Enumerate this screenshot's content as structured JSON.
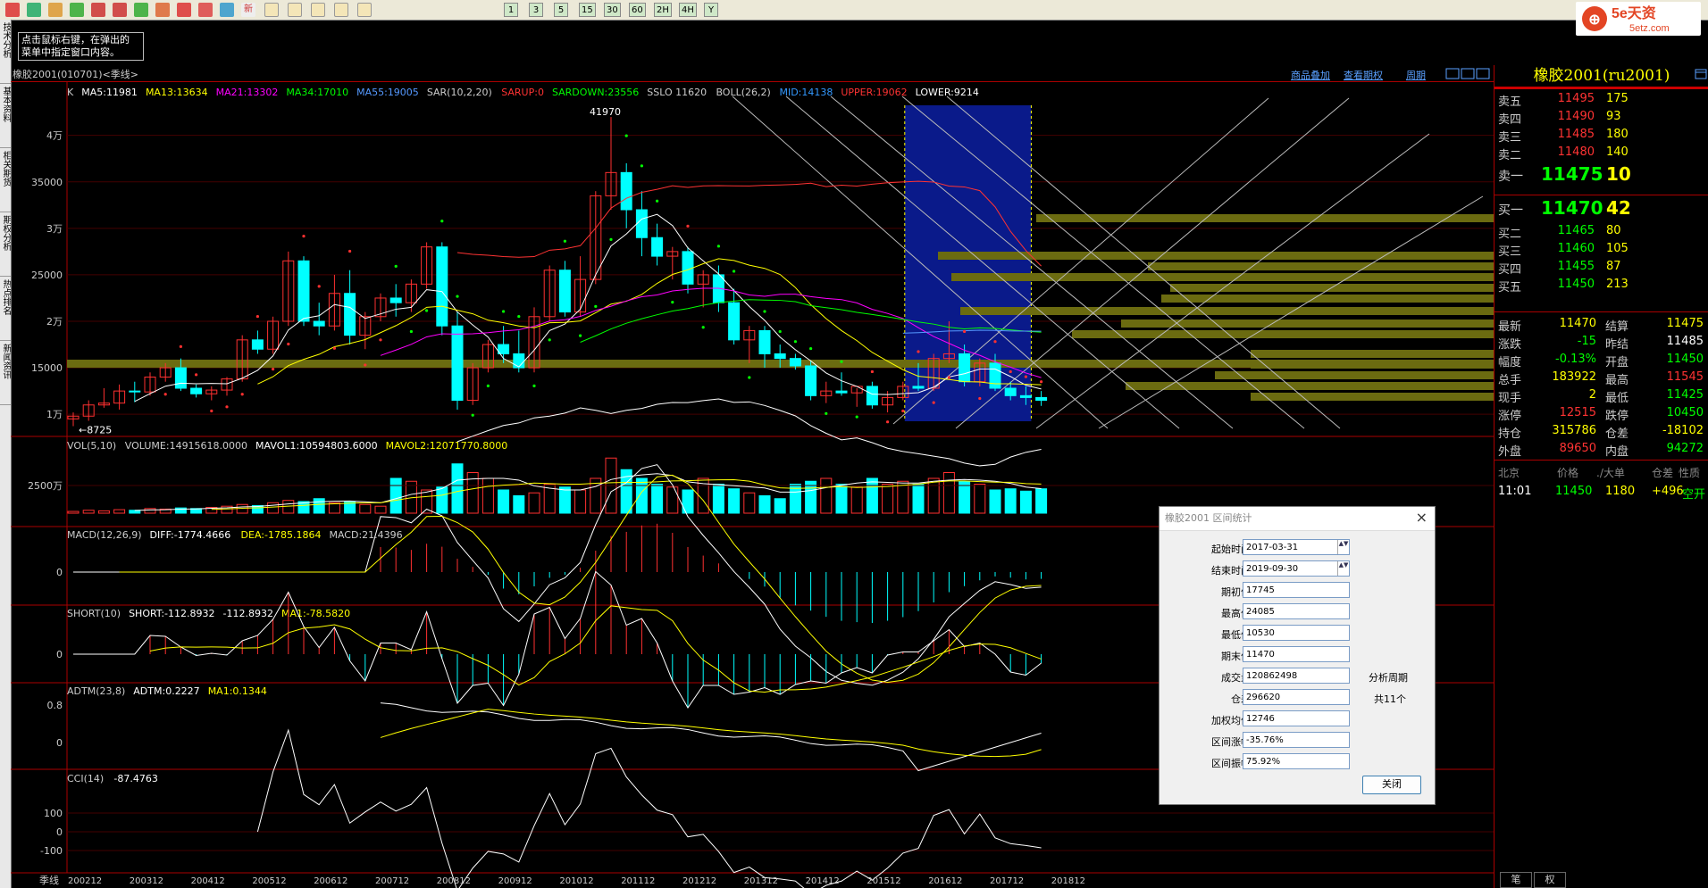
{
  "toolbar": {
    "period_buttons": [
      "1",
      "3",
      "5",
      "15",
      "30",
      "60",
      "2H",
      "4H",
      "Y"
    ],
    "new_label": "新"
  },
  "tooltip": {
    "text1": "点击鼠标右键，在弹出的",
    "text2": "菜单中指定窗口内容。"
  },
  "left_tabs": [
    "技术分析",
    "基本资料",
    "相关期货",
    "期权分析",
    "热点排名",
    "新闻资讯"
  ],
  "chart_header": {
    "title": "橡胶2001(010701)<季线>",
    "links": [
      "商品叠加",
      "查看期权",
      "周期"
    ]
  },
  "main_indicators": [
    {
      "t": "K",
      "c": "#cccccc"
    },
    {
      "t": "MA5:11981",
      "c": "#ffffff"
    },
    {
      "t": "MA13:13634",
      "c": "#ffff00"
    },
    {
      "t": "MA21:13302",
      "c": "#ff00ff"
    },
    {
      "t": "MA34:17010",
      "c": "#00ff00"
    },
    {
      "t": "MA55:19005",
      "c": "#5599ff"
    },
    {
      "t": "SAR(10,2,20)",
      "c": "#cccccc"
    },
    {
      "t": "SARUP:0",
      "c": "#ff3333"
    },
    {
      "t": "SARDOWN:23556",
      "c": "#00ff00"
    },
    {
      "t": "SSLO  11620",
      "c": "#cccccc"
    },
    {
      "t": "BOLL(26,2)",
      "c": "#cccccc"
    },
    {
      "t": "MID:14138",
      "c": "#3399ff"
    },
    {
      "t": "UPPER:19062",
      "c": "#ff3333"
    },
    {
      "t": "LOWER:9214",
      "c": "#ffffff"
    }
  ],
  "main_annotations": {
    "high": "41970",
    "low": "8725"
  },
  "main_yaxis": [
    "4万",
    "35000",
    "3万",
    "25000",
    "2万",
    "15000",
    "1万"
  ],
  "vol_panel": [
    {
      "t": "VOL(5,10)",
      "c": "#cccccc"
    },
    {
      "t": "VOLUME:14915618.0000",
      "c": "#cccccc"
    },
    {
      "t": "MAVOL1:10594803.6000",
      "c": "#ffffff"
    },
    {
      "t": "MAVOL2:12071770.8000",
      "c": "#ffff00"
    }
  ],
  "vol_yaxis": [
    "2500万"
  ],
  "macd_panel": [
    {
      "t": "MACD(12,26,9)",
      "c": "#cccccc"
    },
    {
      "t": "DIFF:-1774.4666",
      "c": "#ffffff"
    },
    {
      "t": "DEA:-1785.1864",
      "c": "#ffff00"
    },
    {
      "t": "MACD:21.4396",
      "c": "#cccccc"
    }
  ],
  "macd_yaxis": [
    "0"
  ],
  "short_panel": [
    {
      "t": "SHORT(10)",
      "c": "#cccccc"
    },
    {
      "t": "SHORT:-112.8932",
      "c": "#ffffff"
    },
    {
      "t": "-112.8932",
      "c": "#ffffff"
    },
    {
      "t": "MA1:-78.5820",
      "c": "#ffff00"
    }
  ],
  "short_yaxis": [
    "0"
  ],
  "adtm_panel": [
    {
      "t": "ADTM(23,8)",
      "c": "#cccccc"
    },
    {
      "t": "ADTM:0.2227",
      "c": "#ffffff"
    },
    {
      "t": "MA1:0.1344",
      "c": "#ffff00"
    }
  ],
  "adtm_yaxis": [
    "0.8",
    "0"
  ],
  "cci_panel": [
    {
      "t": "CCI(14)",
      "c": "#cccccc"
    },
    {
      "t": "-87.4763",
      "c": "#ffffff"
    }
  ],
  "cci_yaxis": [
    "100",
    "0",
    "-100"
  ],
  "xaxis": {
    "period_label": "季线",
    "ticks": [
      "200212",
      "200312",
      "200412",
      "200512",
      "200612",
      "200712",
      "200812",
      "200912",
      "201012",
      "201112",
      "201212",
      "201312",
      "201412",
      "201512",
      "201612",
      "201712",
      "201812"
    ]
  },
  "quote": {
    "title": "橡胶2001(ru2001)",
    "asks": [
      {
        "label": "卖五",
        "price": "11495",
        "vol": "175"
      },
      {
        "label": "卖四",
        "price": "11490",
        "vol": "93"
      },
      {
        "label": "卖三",
        "price": "11485",
        "vol": "180"
      },
      {
        "label": "卖二",
        "price": "11480",
        "vol": "140"
      },
      {
        "label": "卖一",
        "price": "11475",
        "vol": "10"
      }
    ],
    "bids": [
      {
        "label": "买一",
        "price": "11470",
        "vol": "42"
      },
      {
        "label": "买二",
        "price": "11465",
        "vol": "80"
      },
      {
        "label": "买三",
        "price": "11460",
        "vol": "105"
      },
      {
        "label": "买四",
        "price": "11455",
        "vol": "87"
      },
      {
        "label": "买五",
        "price": "11450",
        "vol": "213"
      }
    ],
    "stats": [
      {
        "l1": "最新",
        "v1": "11470",
        "c1": "#ffff00",
        "l2": "结算",
        "v2": "11475",
        "c2": "#ffff00"
      },
      {
        "l1": "涨跌",
        "v1": "-15",
        "c1": "#00ff00",
        "l2": "昨结",
        "v2": "11485",
        "c2": "#ffffff"
      },
      {
        "l1": "幅度",
        "v1": "-0.13%",
        "c1": "#00ff00",
        "l2": "开盘",
        "v2": "11450",
        "c2": "#00ff00"
      },
      {
        "l1": "总手",
        "v1": "183922",
        "c1": "#ffff00",
        "l2": "最高",
        "v2": "11545",
        "c2": "#ff3333"
      },
      {
        "l1": "现手",
        "v1": "2",
        "c1": "#ffff00",
        "l2": "最低",
        "v2": "11425",
        "c2": "#00ff00"
      },
      {
        "l1": "涨停",
        "v1": "12515",
        "c1": "#ff3333",
        "l2": "跌停",
        "v2": "10450",
        "c2": "#00ff00"
      },
      {
        "l1": "持仓",
        "v1": "315786",
        "c1": "#ffff00",
        "l2": "仓差",
        "v2": "-18102",
        "c2": "#ffff00"
      },
      {
        "l1": "外盘",
        "v1": "89650",
        "c1": "#ff3333",
        "l2": "内盘",
        "v2": "94272",
        "c2": "#00ff00"
      }
    ],
    "tick_header": [
      "北京",
      "价格",
      "./大单",
      "仓差",
      "性质"
    ],
    "tick_row": {
      "time": "11:01",
      "price": "11450",
      "vol": "1180",
      "diff": "+496",
      "type": "空开"
    },
    "bottom_tabs": [
      "笔",
      "权"
    ]
  },
  "dialog": {
    "title": "橡胶2001 区间统计",
    "fields": [
      {
        "label": "起始时间",
        "value": "2017-03-31",
        "spin": true
      },
      {
        "label": "结束时间",
        "value": "2019-09-30",
        "spin": true
      },
      {
        "label": "期初价",
        "value": "17745"
      },
      {
        "label": "最高价",
        "value": "24085"
      },
      {
        "label": "最低价",
        "value": "10530"
      },
      {
        "label": "期末价",
        "value": "11470"
      },
      {
        "label": "成交量",
        "value": "120862498"
      },
      {
        "label": "仓差",
        "value": "296620"
      },
      {
        "label": "加权均价",
        "value": "12746"
      },
      {
        "label": "区间涨幅",
        "value": "-35.76%"
      },
      {
        "label": "区间振幅",
        "value": "75.92%"
      }
    ],
    "side_label1": "分析周期",
    "side_label2": "共11个",
    "close_label": "关闭"
  },
  "chart_data": {
    "type": "candlestick",
    "ylim": [
      8000,
      44000
    ],
    "candles": [
      [
        9500,
        10200,
        8725,
        9800
      ],
      [
        9800,
        11500,
        9300,
        11000
      ],
      [
        11000,
        12800,
        10700,
        11200
      ],
      [
        11200,
        13200,
        10500,
        12500
      ],
      [
        12500,
        13500,
        11300,
        12400
      ],
      [
        12400,
        14500,
        12000,
        14000
      ],
      [
        14000,
        15500,
        13500,
        15000
      ],
      [
        15000,
        16000,
        12500,
        12800
      ],
      [
        12800,
        13200,
        11800,
        12200
      ],
      [
        12200,
        13000,
        11500,
        12600
      ],
      [
        12600,
        14000,
        12000,
        13800
      ],
      [
        13800,
        18500,
        13500,
        18000
      ],
      [
        18000,
        19000,
        16500,
        17000
      ],
      [
        17000,
        20500,
        16500,
        20000
      ],
      [
        20000,
        27500,
        19500,
        26500
      ],
      [
        26500,
        27000,
        19500,
        20000
      ],
      [
        20000,
        22000,
        18500,
        19500
      ],
      [
        19500,
        25000,
        19000,
        23000
      ],
      [
        23000,
        25500,
        17500,
        18500
      ],
      [
        18500,
        21000,
        17000,
        20500
      ],
      [
        20500,
        23000,
        20000,
        22500
      ],
      [
        22500,
        24000,
        20500,
        22000
      ],
      [
        22000,
        24500,
        21000,
        24000
      ],
      [
        24000,
        28500,
        23500,
        28000
      ],
      [
        28000,
        28500,
        18500,
        19500
      ],
      [
        19500,
        21000,
        10500,
        11500
      ],
      [
        11500,
        15500,
        11000,
        15000
      ],
      [
        15000,
        18000,
        14500,
        17500
      ],
      [
        17500,
        19500,
        15500,
        16500
      ],
      [
        16500,
        19000,
        14500,
        15000
      ],
      [
        15000,
        21500,
        14500,
        20500
      ],
      [
        20500,
        26000,
        20000,
        25500
      ],
      [
        25500,
        26500,
        20500,
        21000
      ],
      [
        21000,
        27000,
        20500,
        24500
      ],
      [
        24500,
        34000,
        24000,
        33500
      ],
      [
        33500,
        41970,
        32000,
        36000
      ],
      [
        36000,
        37000,
        30000,
        32000
      ],
      [
        32000,
        34000,
        27000,
        29000
      ],
      [
        29000,
        30500,
        26000,
        27000
      ],
      [
        27000,
        28000,
        24500,
        27500
      ],
      [
        27500,
        28000,
        23000,
        24000
      ],
      [
        24000,
        25500,
        21500,
        25000
      ],
      [
        25000,
        26000,
        21000,
        22000
      ],
      [
        22000,
        23500,
        17500,
        18000
      ],
      [
        18000,
        19500,
        15500,
        19000
      ],
      [
        19000,
        19500,
        15000,
        16500
      ],
      [
        16500,
        17500,
        15000,
        16000
      ],
      [
        16000,
        16500,
        14800,
        15200
      ],
      [
        15200,
        15800,
        11500,
        12000
      ],
      [
        12000,
        13500,
        11200,
        12500
      ],
      [
        12500,
        14500,
        12000,
        12300
      ],
      [
        12300,
        12800,
        10800,
        13000
      ],
      [
        13000,
        13500,
        10600,
        11000
      ],
      [
        11000,
        12500,
        10200,
        11800
      ],
      [
        11800,
        13500,
        11500,
        13000
      ],
      [
        13000,
        15500,
        12500,
        12800
      ],
      [
        12800,
        16500,
        12500,
        16000
      ],
      [
        16000,
        20000,
        15500,
        16500
      ],
      [
        16500,
        17500,
        13000,
        13500
      ],
      [
        13500,
        16000,
        13000,
        15500
      ],
      [
        15500,
        16500,
        12500,
        12800
      ],
      [
        12800,
        13500,
        11500,
        12000
      ],
      [
        12000,
        13000,
        11000,
        11800
      ],
      [
        11800,
        12500,
        10900,
        11500
      ]
    ],
    "highlight_range": [
      "2017-03-31",
      "2019-09-30"
    ]
  }
}
